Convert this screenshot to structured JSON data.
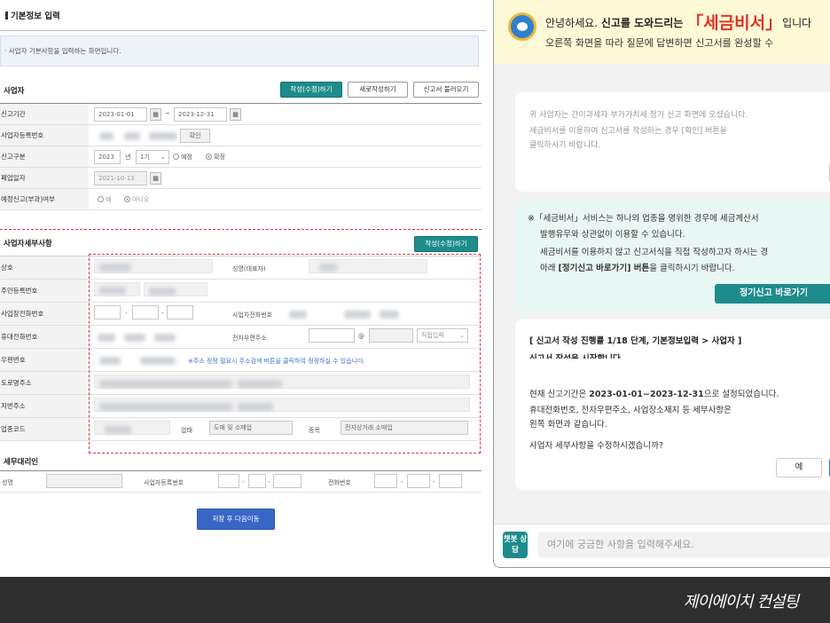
{
  "form": {
    "page_title": "기본정보 입력",
    "info_text": "· 사업자 기본사항을 입력하는 화면입니다.",
    "section1_title": "사업자",
    "buttons": {
      "edit": "작성(수정)하기",
      "new": "새로작성하기",
      "load": "신고서 불러오기"
    },
    "labels": {
      "period": "신고기간",
      "bizno": "사업자등록번호",
      "type": "신고구분",
      "closing": "폐업일자",
      "postcheck": "예정신고(부과)여부"
    },
    "period_start": "2023-01-01",
    "period_sep": "~",
    "period_end": "2023-12-31",
    "confirm_btn": "확인",
    "year_value": "2023",
    "year_unit": "년",
    "term_value": "1기",
    "radio_pre": "예정",
    "radio_final": "확정",
    "closing_value": "2021-10-13",
    "radio_yes": "예",
    "radio_no": "아니오",
    "calendar_glyph": "▦",
    "section2_title": "사업자세부사항",
    "section2_btn": "작성(수정)하기",
    "labels2": {
      "company": "상호",
      "name": "성명(대표자)",
      "rrn": "주민등록번호",
      "bizphone": "사업장전화번호",
      "bizphone2": "사업자전화번호",
      "mobile": "휴대전화번호",
      "email": "전자우편주소",
      "email_at": "@",
      "email_select": "직접입력",
      "zip": "우편번호",
      "road": "도로명주소",
      "jibun": "지번주소",
      "industry": "업종코드",
      "biz_type": "업태",
      "biz_item": "종목"
    },
    "zip_note": "※주소 정정 필요시 주소검색 버튼을 클릭하여 정정하실 수 있습니다.",
    "biz_type_value": "도매 및 소매업",
    "biz_item_value": "전자상거래 소매업",
    "section3_title": "세무대리인",
    "labels3": {
      "name": "성명",
      "bizno": "사업자등록번호",
      "phone": "전화번호"
    },
    "dash": "-",
    "save_next": "저장 후 다음이동"
  },
  "chat": {
    "banner_l1a": "안녕하세요.",
    "banner_l1b": "신고를 도와드리는",
    "banner_brand": "「세금비서」",
    "banner_l1c": "입니다",
    "banner_l2": "오른쪽 화면을 따라 질문에 답변하면 신고서를 완성할 수",
    "msg1_l1": "귀 사업자는 간이과세자 부가가치세 정기 신고 화면에 오셨습니다.",
    "msg1_l2": "세금비서를 이용하여 신고서를 작성하는 경우 [확인] 버튼을",
    "msg1_l3": "클릭하시기 바랍니다.",
    "msg2_l1": "※「세금비서」서비스는 하나의 업종을 영위한 경우에 세금계산서",
    "msg2_l2": "발행유무와 상관없이 이용할 수 있습니다.",
    "msg2_l3": "세금비서를 이용하지 않고 신고서식을 직접 작성하고자 하시는 경",
    "msg2_l4a": "아래",
    "msg2_l4b": "[정기신고 바로가기] 버튼",
    "msg2_l4c": "을 클릭하시기 바랍니다.",
    "msg2_btn": "정기신고 바로가기",
    "msg3_head": "[ 신고서 작성 진행률 1/18 단계, 기본정보입력 > 사업자 ]",
    "msg3_sub": "신고서 작성을 시작합니다",
    "msg3_l1a": "현재 신고기간은",
    "msg3_l1b": "2023-01-01~2023-12-31",
    "msg3_l1c": "으로 설정되었습니다.",
    "msg3_l2": "휴대전화번호, 전자우편주소, 사업장소재지 등 세부사항은",
    "msg3_l3": "왼쪽 화면과 같습니다.",
    "msg3_l4": "사업자 세부사항을 수정하시겠습니까?",
    "yes": "예",
    "chatbot_label": "챗봇 상담",
    "input_placeholder": "여기에 궁금한 사항을 입력해주세요."
  },
  "footer_brand": "제이에이치 컨설팅"
}
